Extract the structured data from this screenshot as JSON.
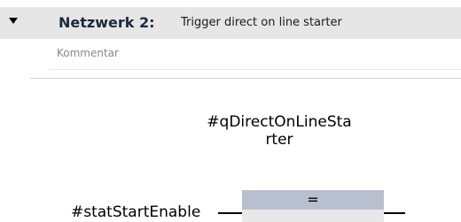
{
  "network": {
    "label": "Netzwerk 2:",
    "title": "Trigger direct on line starter",
    "comment_placeholder": "Kommentar"
  },
  "ladder": {
    "output_operand": "#qDirectOnLineStarter",
    "coil_symbol": "=",
    "input_operand": "#statStartEnable"
  },
  "icons": {
    "collapse": "collapse-triangle-icon"
  },
  "colors": {
    "header_bg": "#e6e6e6",
    "coil_header": "#b8bfcf",
    "coil_body": "#e8e8e8",
    "network_label": "#1a2a3a"
  }
}
